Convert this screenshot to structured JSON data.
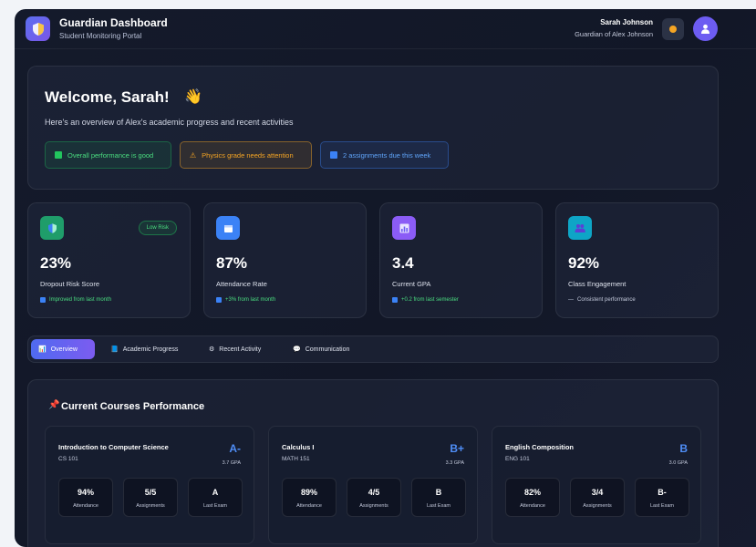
{
  "header": {
    "app_title": "Guardian Dashboard",
    "app_subtitle": "Student Monitoring Portal",
    "user_name": "Sarah Johnson",
    "user_role": "Guardian of Alex Johnson",
    "logo_icon": "shield-icon",
    "notification_icon": "bell-icon",
    "avatar_icon": "user-icon"
  },
  "welcome": {
    "title": "Welcome, Sarah!",
    "wave_icon": "👋",
    "subtitle": "Here's an overview of Alex's academic progress and recent activities",
    "alerts": [
      {
        "text": "Overall performance is good",
        "color": "#22c55e",
        "icon": "check-icon"
      },
      {
        "text": "Physics grade needs attention",
        "color": "#f5a524",
        "icon": "warning-icon"
      },
      {
        "text": "2 assignments due this week",
        "color": "#3b82f6",
        "icon": "info-icon"
      }
    ]
  },
  "stats": [
    {
      "value": "23%",
      "label": "Dropout Risk Score",
      "trend": "Improved from last month",
      "trend_color": "#4ade80",
      "icon": "shield-icon",
      "icon_color": "#1f9d6a",
      "badge": "Low Risk"
    },
    {
      "value": "87%",
      "label": "Attendance Rate",
      "trend": "+3% from last month",
      "trend_color": "#4ade80",
      "icon": "calendar-icon",
      "icon_color": "#3b82f6"
    },
    {
      "value": "3.4",
      "label": "Current GPA",
      "trend": "+0.2 from last semester",
      "trend_color": "#4ade80",
      "icon": "bar-chart-icon",
      "icon_color": "#8b5cf6"
    },
    {
      "value": "92%",
      "label": "Class Engagement",
      "trend": "Consistent performance",
      "trend_color": "#c3c9db",
      "icon": "users-icon",
      "icon_color": "#0ea5c6"
    }
  ],
  "tabs": [
    {
      "label": "Overview",
      "icon": "📊",
      "active": true
    },
    {
      "label": "Academic Progress",
      "icon": "📘"
    },
    {
      "label": "Recent Activity",
      "icon": "⚙"
    },
    {
      "label": "Communication",
      "icon": "💬"
    }
  ],
  "courses": {
    "title": "Current Courses Performance",
    "title_icon": "📌",
    "items": [
      {
        "name": "Introduction to Computer Science",
        "code": "CS 101",
        "grade": "A-",
        "gpa": "3.7 GPA",
        "metrics": [
          {
            "value": "94%",
            "label": "Attendance"
          },
          {
            "value": "5/5",
            "label": "Assignments"
          },
          {
            "value": "A",
            "label": "Last Exam"
          }
        ]
      },
      {
        "name": "Calculus I",
        "code": "MATH 151",
        "grade": "B+",
        "gpa": "3.3 GPA",
        "metrics": [
          {
            "value": "89%",
            "label": "Attendance"
          },
          {
            "value": "4/5",
            "label": "Assignments"
          },
          {
            "value": "B",
            "label": "Last Exam"
          }
        ]
      },
      {
        "name": "English Composition",
        "code": "ENG 101",
        "grade": "B",
        "gpa": "3.0 GPA",
        "metrics": [
          {
            "value": "82%",
            "label": "Attendance"
          },
          {
            "value": "3/4",
            "label": "Assignments"
          },
          {
            "value": "B-",
            "label": "Last Exam"
          }
        ]
      }
    ]
  }
}
